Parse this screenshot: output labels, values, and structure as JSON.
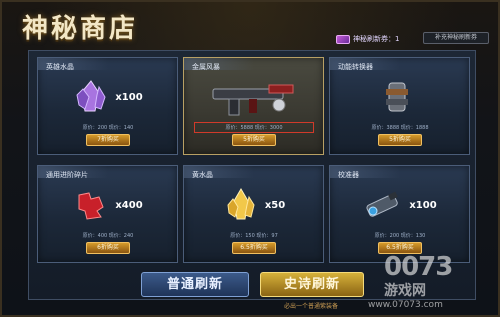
{
  "header": {
    "title": "神秘商店",
    "ticket_label": "神秘刷新券：1",
    "exchange_label": "补充神秘刷新券"
  },
  "items": [
    {
      "name": "英雄水晶",
      "quantity": "x100",
      "price_line": "原价：200  现价：140",
      "button": "7折购买",
      "selected": false,
      "icon": "purple-crystal-icon"
    },
    {
      "name": "金属风暴",
      "quantity": "",
      "price_line": "原价：5888  现价：3000",
      "button": "5折购买",
      "selected": true,
      "icon": "metal-storm-gun-icon"
    },
    {
      "name": "动能转换器",
      "quantity": "",
      "price_line": "原价：3888  现价：1888",
      "button": "5折购买",
      "selected": false,
      "icon": "kinetic-converter-icon"
    },
    {
      "name": "通用进阶碎片",
      "quantity": "x400",
      "price_line": "原价：400  现价：240",
      "button": "6折购买",
      "selected": false,
      "icon": "red-puzzle-fragment-icon"
    },
    {
      "name": "黄水晶",
      "quantity": "x50",
      "price_line": "原价：150  现价：97",
      "button": "6.5折购买",
      "selected": false,
      "icon": "yellow-crystal-icon"
    },
    {
      "name": "校准器",
      "quantity": "x100",
      "price_line": "原价：200  现价：130",
      "button": "6.5折购买",
      "selected": false,
      "icon": "calibrator-icon"
    }
  ],
  "footer": {
    "normal_refresh": "普通刷新",
    "epic_refresh": "史诗刷新",
    "epic_hint": "必出一个普通紫装备"
  },
  "watermark": {
    "logo": "0073",
    "cn": "游戏网",
    "url": "www.07073.com"
  }
}
